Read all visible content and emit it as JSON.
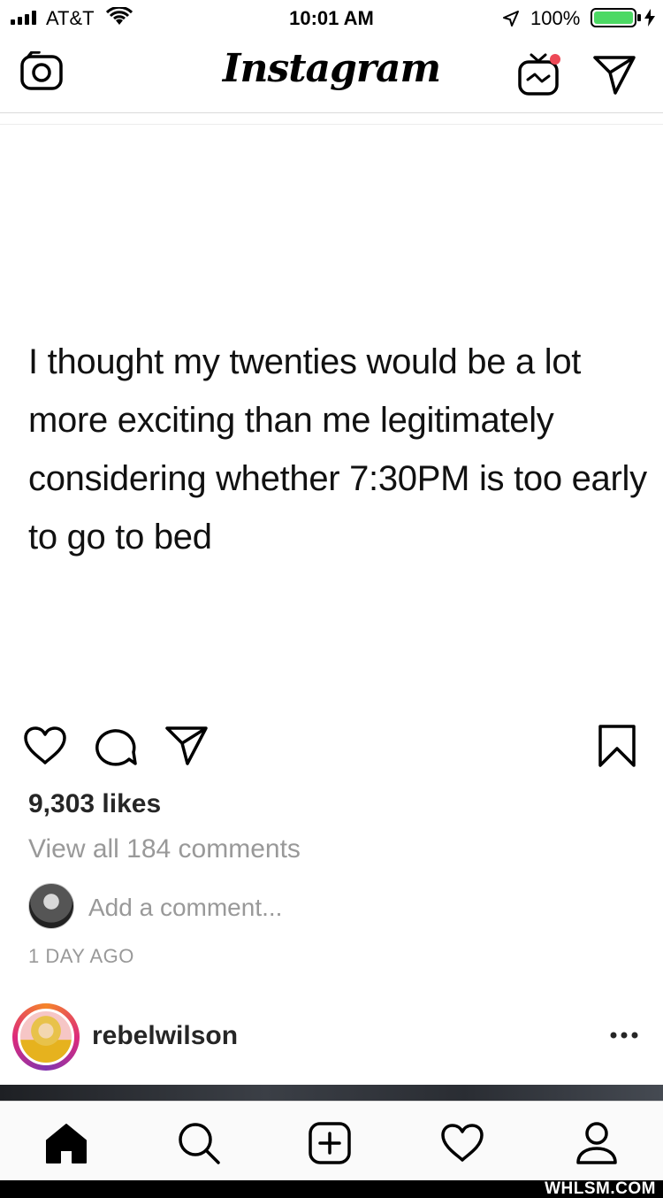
{
  "status_bar": {
    "carrier": "AT&T",
    "time": "10:01 AM",
    "battery": "100%",
    "battery_color": "#4cd964"
  },
  "nav": {
    "logo": "Instagram",
    "icons": [
      "camera-icon",
      "igtv-icon",
      "direct-message-icon"
    ],
    "notification_dot_color": "#ed4956"
  },
  "post": {
    "text": "I thought my twenties would be a lot more exciting than me legitimately considering whether 7:30PM is too early to go to bed",
    "likes": "9,303 likes",
    "view_comments": "View all 184 comments",
    "add_comment_placeholder": "Add a comment...",
    "time_ago": "1 DAY AGO"
  },
  "next_post": {
    "username": "rebelwilson"
  },
  "tab_bar": {
    "icons": [
      "home-icon",
      "search-icon",
      "add-post-icon",
      "activity-heart-icon",
      "profile-icon"
    ]
  },
  "watermark": "WHLSM.COM"
}
